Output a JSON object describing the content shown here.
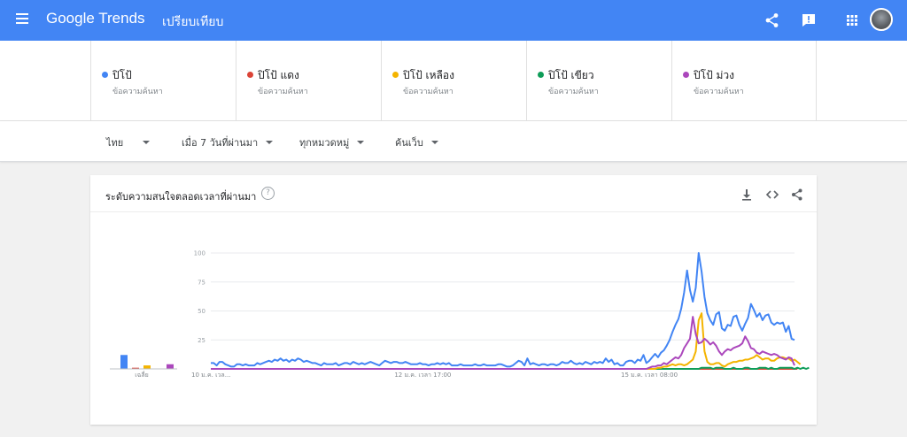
{
  "header": {
    "brand_google": "Google",
    "brand_trends": "Trends",
    "page_label": "เปรียบเทียบ",
    "icons": [
      "menu-icon",
      "share-icon",
      "feedback-icon",
      "apps-icon",
      "avatar"
    ]
  },
  "terms": [
    {
      "name": "ปิโป้",
      "sub": "ข้อความค้นหา",
      "color": "#4285f4"
    },
    {
      "name": "ปิโป้ แดง",
      "sub": "ข้อความค้นหา",
      "color": "#db4437"
    },
    {
      "name": "ปิโป้ เหลือง",
      "sub": "ข้อความค้นหา",
      "color": "#f4b400"
    },
    {
      "name": "ปิโป้ เขียว",
      "sub": "ข้อความค้นหา",
      "color": "#0f9d58"
    },
    {
      "name": "ปิโป้ ม่วง",
      "sub": "ข้อความค้นหา",
      "color": "#ab47bc"
    }
  ],
  "filters": {
    "region": "ไทย",
    "time": "เมื่อ 7 วันที่ผ่านมา",
    "category": "ทุกหมวดหมู่",
    "search_type": "ค้นเว็บ"
  },
  "card": {
    "title": "ระดับความสนใจตลอดเวลาที่ผ่านมา",
    "help": "?",
    "icons": [
      "download-icon",
      "embed-icon",
      "share-icon"
    ]
  },
  "chart_data": {
    "type": "line",
    "title": "",
    "xlabel": "",
    "ylabel": "",
    "ylim": [
      0,
      100
    ],
    "yticks": [
      "100",
      "75",
      "50",
      "25"
    ],
    "grid": true,
    "legend": "none",
    "x_tick_labels": [
      "10 ม.ค. เวล...",
      "12 ม.ค. เวลา 17:00",
      "15 ม.ค. เวลา 08:00"
    ],
    "x_tick_index": [
      0,
      73,
      151
    ],
    "averages": {
      "label": "เฉลี่ย",
      "values": [
        12,
        1,
        3,
        0,
        4
      ],
      "colors": [
        "#4285f4",
        "#db4437",
        "#f4b400",
        "#0f9d58",
        "#ab47bc"
      ]
    },
    "series": [
      {
        "name": "ปิโป้",
        "color": "#4285f4",
        "values": [
          5,
          5,
          3,
          6,
          6,
          4,
          3,
          2,
          2,
          4,
          4,
          3,
          4,
          3,
          3,
          3,
          5,
          4,
          5,
          6,
          7,
          6,
          8,
          7,
          9,
          7,
          8,
          6,
          8,
          7,
          9,
          8,
          6,
          7,
          6,
          5,
          5,
          4,
          3,
          5,
          4,
          4,
          4,
          5,
          3,
          4,
          5,
          5,
          4,
          6,
          5,
          4,
          5,
          4,
          5,
          6,
          5,
          4,
          3,
          5,
          7,
          6,
          5,
          6,
          6,
          5,
          5,
          6,
          5,
          4,
          4,
          4,
          5,
          4,
          4,
          3,
          4,
          4,
          5,
          4,
          5,
          4,
          5,
          3,
          3,
          3,
          4,
          3,
          3,
          3,
          3,
          4,
          3,
          3,
          4,
          3,
          3,
          3,
          3,
          4,
          4,
          3,
          2,
          2,
          3,
          5,
          7,
          6,
          3,
          9,
          4,
          5,
          4,
          3,
          4,
          4,
          3,
          4,
          4,
          3,
          4,
          6,
          5,
          5,
          7,
          5,
          4,
          5,
          4,
          6,
          5,
          4,
          6,
          5,
          6,
          5,
          9,
          6,
          8,
          4,
          5,
          3,
          3,
          6,
          7,
          7,
          5,
          8,
          7,
          12,
          5,
          7,
          10,
          13,
          10,
          14,
          16,
          20,
          25,
          32,
          38,
          43,
          52,
          66,
          85,
          68,
          58,
          70,
          100,
          84,
          62,
          48,
          42,
          38,
          47,
          49,
          35,
          33,
          38,
          37,
          45,
          46,
          38,
          33,
          39,
          44,
          56,
          51,
          45,
          48,
          42,
          46,
          47,
          40,
          38,
          40,
          39,
          40,
          32,
          37,
          26,
          25
        ]
      },
      {
        "name": "ปิโป้ แดง",
        "color": "#db4437",
        "values": [
          0,
          0,
          0,
          0,
          0,
          0,
          0,
          0,
          0,
          0,
          0,
          0,
          0,
          0,
          0,
          0,
          0,
          0,
          0,
          0,
          0,
          0,
          0,
          0,
          0,
          0,
          0,
          0,
          0,
          0,
          0,
          0,
          0,
          0,
          0,
          0,
          0,
          0,
          0,
          0,
          0,
          0,
          0,
          0,
          0,
          0,
          0,
          0,
          0,
          0,
          0,
          0,
          0,
          0,
          0,
          0,
          0,
          0,
          0,
          0,
          0,
          0,
          0,
          0,
          0,
          0,
          0,
          0,
          0,
          0,
          0,
          0,
          0,
          0,
          0,
          0,
          0,
          0,
          0,
          0,
          0,
          0,
          0,
          0,
          0,
          0,
          0,
          0,
          0,
          0,
          0,
          0,
          0,
          0,
          0,
          0,
          0,
          0,
          0,
          0,
          0,
          0,
          0,
          0,
          0,
          0,
          0,
          0,
          0,
          0,
          0,
          0,
          0,
          0,
          0,
          0,
          0,
          0,
          0,
          0,
          0,
          0,
          0,
          0,
          0,
          0,
          0,
          0,
          0,
          0,
          0,
          0,
          0,
          0,
          0,
          0,
          0,
          0,
          0,
          0,
          0,
          0,
          0,
          0,
          0,
          0,
          0,
          0,
          0,
          0,
          0,
          0,
          0,
          0,
          0,
          0,
          0,
          0,
          0,
          0,
          0,
          0,
          0,
          0,
          0,
          0,
          0,
          0,
          0,
          0,
          0,
          0,
          0,
          0,
          0,
          0,
          0,
          0,
          0,
          0,
          0,
          0,
          0,
          0,
          0,
          0,
          0,
          0,
          0,
          0,
          0,
          0,
          0,
          0,
          0,
          0,
          0,
          0,
          0,
          0,
          0,
          0,
          0
        ]
      },
      {
        "name": "ปิโป้ เหลือง",
        "color": "#f4b400",
        "values": [
          0,
          0,
          0,
          0,
          0,
          0,
          0,
          0,
          0,
          0,
          0,
          0,
          0,
          0,
          0,
          0,
          0,
          0,
          0,
          0,
          0,
          0,
          0,
          0,
          0,
          0,
          0,
          0,
          0,
          0,
          0,
          0,
          0,
          0,
          0,
          0,
          0,
          0,
          0,
          0,
          0,
          0,
          0,
          0,
          0,
          0,
          0,
          0,
          0,
          0,
          0,
          0,
          0,
          0,
          0,
          0,
          0,
          0,
          0,
          0,
          0,
          0,
          0,
          0,
          0,
          0,
          0,
          0,
          0,
          0,
          0,
          0,
          0,
          0,
          0,
          0,
          0,
          0,
          0,
          0,
          0,
          0,
          0,
          0,
          0,
          0,
          0,
          0,
          0,
          0,
          0,
          0,
          0,
          0,
          0,
          0,
          0,
          0,
          0,
          0,
          0,
          0,
          0,
          0,
          0,
          0,
          0,
          0,
          0,
          0,
          0,
          0,
          0,
          0,
          0,
          0,
          0,
          0,
          0,
          0,
          0,
          0,
          0,
          0,
          0,
          0,
          0,
          0,
          0,
          0,
          0,
          0,
          0,
          0,
          0,
          0,
          0,
          0,
          0,
          0,
          0,
          0,
          0,
          0,
          0,
          0,
          0,
          0,
          0,
          0,
          0,
          0,
          0,
          0,
          1,
          1,
          2,
          2,
          3,
          4,
          3,
          4,
          4,
          3,
          4,
          6,
          8,
          15,
          42,
          48,
          15,
          6,
          4,
          4,
          5,
          5,
          3,
          2,
          4,
          5,
          6,
          6,
          7,
          7,
          8,
          8,
          9,
          10,
          12,
          10,
          8,
          9,
          9,
          7,
          7,
          9,
          10,
          10,
          9,
          9,
          7,
          8,
          6,
          4
        ]
      },
      {
        "name": "ปิโป้ เขียว",
        "color": "#0f9d58",
        "values": [
          0,
          0,
          0,
          0,
          0,
          0,
          0,
          0,
          0,
          0,
          0,
          0,
          0,
          0,
          0,
          0,
          0,
          0,
          0,
          0,
          0,
          0,
          0,
          0,
          0,
          0,
          0,
          0,
          0,
          0,
          0,
          0,
          0,
          0,
          0,
          0,
          0,
          0,
          0,
          0,
          0,
          0,
          0,
          0,
          0,
          0,
          0,
          0,
          0,
          0,
          0,
          0,
          0,
          0,
          0,
          0,
          0,
          0,
          0,
          0,
          0,
          0,
          0,
          0,
          0,
          0,
          0,
          0,
          0,
          0,
          0,
          0,
          0,
          0,
          0,
          0,
          0,
          0,
          0,
          0,
          0,
          0,
          0,
          0,
          0,
          0,
          0,
          0,
          0,
          0,
          0,
          0,
          0,
          0,
          0,
          0,
          0,
          0,
          0,
          0,
          0,
          0,
          0,
          0,
          0,
          0,
          0,
          0,
          0,
          0,
          0,
          0,
          0,
          0,
          0,
          0,
          0,
          0,
          0,
          0,
          0,
          0,
          0,
          0,
          0,
          0,
          0,
          0,
          0,
          0,
          0,
          0,
          0,
          0,
          0,
          0,
          0,
          0,
          0,
          0,
          0,
          0,
          0,
          0,
          0,
          0,
          0,
          0,
          0,
          0,
          0,
          0,
          0,
          0,
          0,
          0,
          0,
          0,
          0,
          0,
          0,
          0,
          0,
          0,
          0,
          0,
          0,
          0,
          0,
          1,
          1,
          1,
          1,
          0,
          1,
          1,
          1,
          0,
          0,
          0,
          1,
          0,
          0,
          0,
          1,
          1,
          0,
          0,
          0,
          1,
          1,
          1,
          0,
          1,
          0,
          0,
          1,
          1,
          1,
          1,
          1,
          0,
          1,
          0,
          1,
          0,
          1
        ]
      },
      {
        "name": "ปิโป้ ม่วง",
        "color": "#ab47bc",
        "values": [
          0,
          0,
          0,
          0,
          0,
          0,
          0,
          0,
          0,
          0,
          0,
          0,
          0,
          0,
          0,
          0,
          0,
          0,
          0,
          0,
          0,
          0,
          0,
          0,
          0,
          0,
          0,
          0,
          0,
          0,
          0,
          0,
          0,
          0,
          0,
          0,
          0,
          0,
          0,
          0,
          0,
          0,
          0,
          0,
          0,
          0,
          0,
          0,
          0,
          0,
          0,
          0,
          0,
          0,
          0,
          0,
          0,
          0,
          0,
          0,
          0,
          0,
          0,
          0,
          0,
          0,
          0,
          0,
          0,
          0,
          0,
          0,
          0,
          0,
          0,
          0,
          0,
          0,
          0,
          0,
          0,
          0,
          0,
          0,
          0,
          0,
          0,
          0,
          0,
          0,
          0,
          0,
          0,
          0,
          0,
          0,
          0,
          0,
          0,
          0,
          0,
          0,
          0,
          0,
          0,
          0,
          0,
          0,
          0,
          0,
          0,
          0,
          0,
          0,
          0,
          0,
          0,
          0,
          0,
          0,
          0,
          0,
          0,
          0,
          0,
          0,
          0,
          0,
          0,
          0,
          0,
          0,
          0,
          0,
          0,
          0,
          0,
          0,
          0,
          0,
          0,
          0,
          0,
          0,
          0,
          0,
          0,
          0,
          0,
          0,
          0,
          1,
          2,
          2,
          3,
          3,
          5,
          4,
          6,
          8,
          10,
          9,
          12,
          18,
          22,
          26,
          45,
          30,
          22,
          23,
          26,
          24,
          21,
          23,
          20,
          15,
          12,
          15,
          17,
          16,
          18,
          19,
          20,
          22,
          28,
          24,
          18,
          17,
          14,
          13,
          15,
          14,
          13,
          12,
          13,
          12,
          10,
          9,
          8,
          10,
          9,
          3
        ]
      }
    ]
  }
}
